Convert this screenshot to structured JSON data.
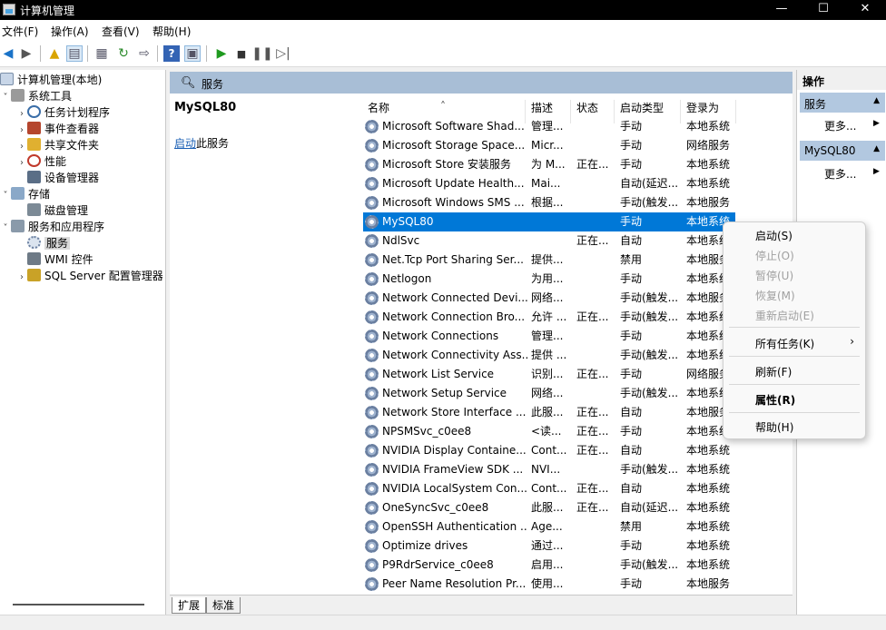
{
  "window": {
    "title": "计算机管理",
    "minimize": "—",
    "maximize": "☐",
    "close": "✕"
  },
  "menu": [
    "文件(F)",
    "操作(A)",
    "查看(V)",
    "帮助(H)"
  ],
  "tree": {
    "root": "计算机管理(本地)",
    "system_tools": "系统工具",
    "task_scheduler": "任务计划程序",
    "event_viewer": "事件查看器",
    "shared_folders": "共享文件夹",
    "performance": "性能",
    "device_manager": "设备管理器",
    "storage": "存储",
    "disk_management": "磁盘管理",
    "services_apps": "服务和应用程序",
    "services": "服务",
    "wmi": "WMI 控件",
    "sql_config": "SQL Server 配置管理器"
  },
  "middle": {
    "header": "服务",
    "selected_service": "MySQL80",
    "start_link": "启动",
    "start_suffix": "此服务"
  },
  "columns": {
    "name": "名称",
    "desc": "描述",
    "status": "状态",
    "startup": "启动类型",
    "logon": "登录为"
  },
  "services": [
    {
      "name": "Microsoft Software Shad...",
      "desc": "管理...",
      "status": "",
      "startup": "手动",
      "logon": "本地系统"
    },
    {
      "name": "Microsoft Storage Space...",
      "desc": "Micr...",
      "status": "",
      "startup": "手动",
      "logon": "网络服务"
    },
    {
      "name": "Microsoft Store 安装服务",
      "desc": "为 M...",
      "status": "正在...",
      "startup": "手动",
      "logon": "本地系统"
    },
    {
      "name": "Microsoft Update Health...",
      "desc": "Mai...",
      "status": "",
      "startup": "自动(延迟...",
      "logon": "本地系统"
    },
    {
      "name": "Microsoft Windows SMS ...",
      "desc": "根据...",
      "status": "",
      "startup": "手动(触发...",
      "logon": "本地服务"
    },
    {
      "name": "MySQL80",
      "desc": "",
      "status": "",
      "startup": "手动",
      "logon": "本地系统"
    },
    {
      "name": "NdlSvc",
      "desc": "",
      "status": "正在...",
      "startup": "自动",
      "logon": "本地系统"
    },
    {
      "name": "Net.Tcp Port Sharing Ser...",
      "desc": "提供...",
      "status": "",
      "startup": "禁用",
      "logon": "本地服务"
    },
    {
      "name": "Netlogon",
      "desc": "为用...",
      "status": "",
      "startup": "手动",
      "logon": "本地系统"
    },
    {
      "name": "Network Connected Devi...",
      "desc": "网络...",
      "status": "",
      "startup": "手动(触发...",
      "logon": "本地服务"
    },
    {
      "name": "Network Connection Bro...",
      "desc": "允许 ...",
      "status": "正在...",
      "startup": "手动(触发...",
      "logon": "本地系统"
    },
    {
      "name": "Network Connections",
      "desc": "管理...",
      "status": "",
      "startup": "手动",
      "logon": "本地系统"
    },
    {
      "name": "Network Connectivity Ass...",
      "desc": "提供 ...",
      "status": "",
      "startup": "手动(触发...",
      "logon": "本地系统"
    },
    {
      "name": "Network List Service",
      "desc": "识别...",
      "status": "正在...",
      "startup": "手动",
      "logon": "网络服务"
    },
    {
      "name": "Network Setup Service",
      "desc": "网络...",
      "status": "",
      "startup": "手动(触发...",
      "logon": "本地系统"
    },
    {
      "name": "Network Store Interface ...",
      "desc": "此服...",
      "status": "正在...",
      "startup": "自动",
      "logon": "本地服务"
    },
    {
      "name": "NPSMSvc_c0ee8",
      "desc": "<读...",
      "status": "正在...",
      "startup": "手动",
      "logon": "本地系统"
    },
    {
      "name": "NVIDIA Display Containe...",
      "desc": "Cont...",
      "status": "正在...",
      "startup": "自动",
      "logon": "本地系统"
    },
    {
      "name": "NVIDIA FrameView SDK ...",
      "desc": "NVI...",
      "status": "",
      "startup": "手动(触发...",
      "logon": "本地系统"
    },
    {
      "name": "NVIDIA LocalSystem Con...",
      "desc": "Cont...",
      "status": "正在...",
      "startup": "自动",
      "logon": "本地系统"
    },
    {
      "name": "OneSyncSvc_c0ee8",
      "desc": "此服...",
      "status": "正在...",
      "startup": "自动(延迟...",
      "logon": "本地系统"
    },
    {
      "name": "OpenSSH Authentication ...",
      "desc": "Age...",
      "status": "",
      "startup": "禁用",
      "logon": "本地系统"
    },
    {
      "name": "Optimize drives",
      "desc": "通过...",
      "status": "",
      "startup": "手动",
      "logon": "本地系统"
    },
    {
      "name": "P9RdrService_c0ee8",
      "desc": "启用...",
      "status": "",
      "startup": "手动(触发...",
      "logon": "本地系统"
    },
    {
      "name": "Peer Name Resolution Pr...",
      "desc": "使用...",
      "status": "",
      "startup": "手动",
      "logon": "本地服务"
    }
  ],
  "tabs": [
    "扩展",
    "标准"
  ],
  "actions": {
    "header": "操作",
    "section1": "服务",
    "section1_more": "更多...",
    "section2": "MySQL80",
    "section2_more": "更多..."
  },
  "context_menu": {
    "start": "启动(S)",
    "stop": "停止(O)",
    "pause": "暂停(U)",
    "resume": "恢复(M)",
    "restart": "重新启动(E)",
    "all_tasks": "所有任务(K)",
    "refresh": "刷新(F)",
    "properties": "属性(R)",
    "help": "帮助(H)"
  },
  "colors": {
    "selection": "#0078d7",
    "pane_header": "#a8bed6",
    "action_section": "#b2c8e0"
  }
}
